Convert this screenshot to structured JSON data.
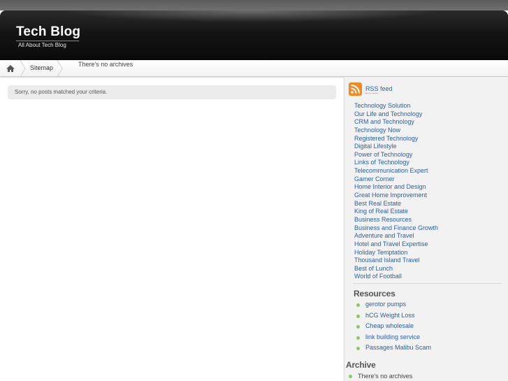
{
  "header": {
    "site_title": "Tech Blog",
    "site_description": "All About Tech Blog"
  },
  "nav": {
    "home_icon": "home-icon",
    "breadcrumb_label": "Sitemap",
    "page_heading": "There's no archives"
  },
  "main": {
    "notice": "Sorry, no posts matched your criteria."
  },
  "sidebar": {
    "rss": {
      "icon": "rss-icon",
      "label": "RSS feed",
      "color": "#f08a24"
    },
    "links": [
      "Technology Solution",
      "Our Life and Technology",
      "CRM and Technology",
      "Technology Now",
      "Registered Technology",
      "Digital Lifestyle",
      "Power of Technology",
      "Links of Technology",
      "Telecommunication Expert",
      "Gamer Corner",
      "Home Interior and Design",
      "Great Home Improvement",
      "Best Real Estate",
      "King of Real Estate",
      "Business Resources",
      "Business and Finance Growth",
      "Adventure and Travel",
      "Hotel and Travel Expertise",
      "Holiday Temptation",
      "Thousand Island Travel",
      "Best of Lunch",
      "World of Football"
    ],
    "resources": {
      "title": "Resources",
      "items": [
        "gerotor pumps",
        "hCG Weight Loss",
        "Cheap wholesale",
        "link building service",
        "Passages Malibu Scam"
      ]
    },
    "archive": {
      "title": "Archive",
      "item": "There's no archives"
    }
  },
  "colors": {
    "link": "#2a5fa4",
    "bullet": "#8fc46a",
    "header_bg": "#141414"
  }
}
